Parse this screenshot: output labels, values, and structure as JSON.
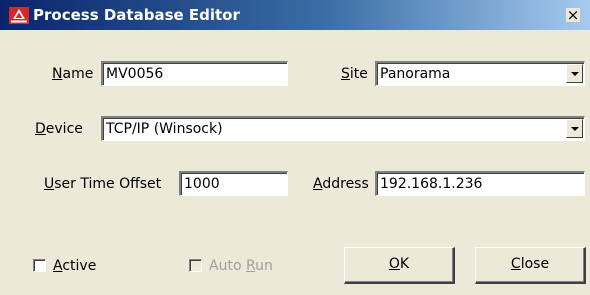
{
  "window": {
    "title": "Process Database Editor",
    "icon": "application-logo-icon",
    "close_glyph": "×"
  },
  "fields": {
    "name": {
      "label_key": "N",
      "label_rest": "ame",
      "value": "MV0056"
    },
    "site": {
      "label_key": "S",
      "label_rest": "ite",
      "value": "Panorama"
    },
    "device": {
      "label_key": "D",
      "label_rest": "evice",
      "value": "TCP/IP (Winsock)"
    },
    "user_time_offset": {
      "label_key": "U",
      "label_rest": "ser Time Offset",
      "value": "1000"
    },
    "address": {
      "label_key": "A",
      "label_rest": "ddress",
      "value": "192.168.1.236"
    }
  },
  "checkboxes": {
    "active": {
      "label_key": "A",
      "label_rest": "ctive",
      "checked": false,
      "enabled": true
    },
    "auto_run": {
      "label_prefix": "Auto ",
      "label_key": "R",
      "label_rest": "un",
      "checked": false,
      "enabled": false
    }
  },
  "buttons": {
    "ok": {
      "label_key": "O",
      "label_rest": "K"
    },
    "close": {
      "label_key": "C",
      "label_rest": "lose"
    }
  },
  "colors": {
    "dialog_background": "#ece9d8",
    "title_bar_start": "#0a246a",
    "title_bar_end": "#a6caf0",
    "title_text": "#ffffff",
    "disabled_text": "#a0a0a0",
    "logo_red": "#d7262c"
  }
}
